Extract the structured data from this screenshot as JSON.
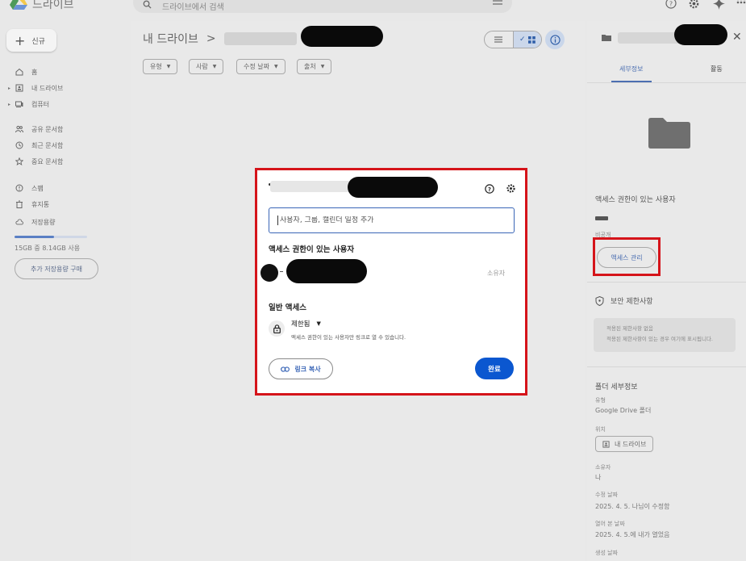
{
  "app": {
    "title": "드라이브",
    "search_placeholder": "드라이브에서 검색"
  },
  "sidebar": {
    "new_label": "신규",
    "items": [
      {
        "label": "홈",
        "icon": "home-icon"
      },
      {
        "label": "내 드라이브",
        "icon": "my-drive-icon"
      },
      {
        "label": "컴퓨터",
        "icon": "computer-icon"
      },
      {
        "label": "공유 문서함",
        "icon": "shared-icon"
      },
      {
        "label": "최근 문서함",
        "icon": "clock-icon"
      },
      {
        "label": "중요 문서함",
        "icon": "star-icon"
      },
      {
        "label": "스팸",
        "icon": "spam-icon"
      },
      {
        "label": "휴지통",
        "icon": "trash-icon"
      },
      {
        "label": "저장용량",
        "icon": "cloud-icon"
      }
    ],
    "storage_text": "15GB 중 8.14GB 사용",
    "storage_fraction": 0.54,
    "buy_storage_label": "추가 저장용량 구매"
  },
  "main": {
    "breadcrumb_root": "내 드라이브",
    "breadcrumb_sep": ">",
    "filters": [
      "유형",
      "사람",
      "수정 날짜",
      "출처"
    ]
  },
  "dialog": {
    "input_placeholder": "사용자, 그룹, 캘린더 일정 추가",
    "people_heading": "액세스 권한이 있는 사용자",
    "owner_role": "소유자",
    "general_access_heading": "일반 액세스",
    "access_mode": "제한됨",
    "access_description": "액세스 권한이 있는 사용자만 링크로 열 수 있습니다.",
    "copy_link_label": "링크 복사",
    "done_label": "완료"
  },
  "details": {
    "tabs": [
      "세부정보",
      "활동"
    ],
    "access_heading": "액세스 권한이 있는 사용자",
    "visibility": "비공개",
    "manage_access_label": "액세스 관리",
    "security_heading": "보안 제한사항",
    "security_line1": "적용된 제한사항 없음",
    "security_line2": "적용된 제한사항이 있는 경우 여기에 표시됩니다.",
    "folder_details_heading": "폴더 세부정보",
    "type_label": "유형",
    "type_value": "Google Drive 폴더",
    "location_label": "위치",
    "location_value": "내 드라이브",
    "owner_label": "소유자",
    "owner_value": "나",
    "modified_label": "수정 날짜",
    "modified_value": "2025. 4. 5. 나님이 수정함",
    "opened_label": "열어 본 날짜",
    "opened_value": "2025. 4. 5.에 내가 열었음",
    "created_label": "생성 날짜"
  }
}
